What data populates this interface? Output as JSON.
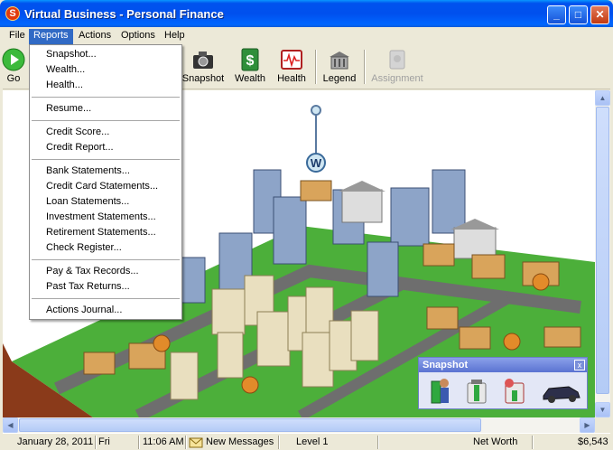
{
  "window": {
    "title": "Virtual Business - Personal Finance",
    "app_icon": "S"
  },
  "menubar": [
    "File",
    "Reports",
    "Actions",
    "Options",
    "Help"
  ],
  "toolbar": {
    "go": "Go",
    "snapshot": "Snapshot",
    "wealth": "Wealth",
    "health": "Health",
    "legend": "Legend",
    "assignment": "Assignment"
  },
  "reports_menu": {
    "items": [
      "Snapshot...",
      "Wealth...",
      "Health...",
      "Resume...",
      "Credit Score...",
      "Credit Report...",
      "Bank Statements...",
      "Credit Card Statements...",
      "Loan Statements...",
      "Investment Statements...",
      "Retirement Statements...",
      "Check Register...",
      "Pay & Tax Records...",
      "Past Tax Returns...",
      "Actions Journal..."
    ]
  },
  "map": {
    "marker_label": "W"
  },
  "snapshot_panel": {
    "title": "Snapshot",
    "close": "x"
  },
  "status": {
    "date": "January 28, 2011",
    "day": "Fri",
    "time": "11:06 AM",
    "messages": "New Messages",
    "level": "Level 1",
    "net_worth_label": "Net Worth",
    "net_worth": "$6,543"
  },
  "colors": {
    "title_bar": "#0053ee",
    "menu_highlight": "#316ac5",
    "grass": "#4caf3a",
    "road": "#6e6e6e"
  }
}
